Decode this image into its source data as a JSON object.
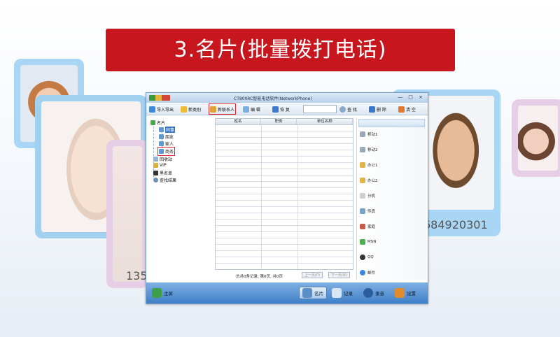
{
  "banner": {
    "title": "3.名片(批量拨打电话)"
  },
  "background": {
    "phone_right": "684920301",
    "phone_left": "135"
  },
  "window": {
    "title": "CT800RC智能电话软件(NetworkPhone)",
    "controls": "— □ ×"
  },
  "toolbar": {
    "import_export": "导入导出",
    "new_category": "新类别",
    "new_contact": "新联系人",
    "edit": "编  辑",
    "restore": "恢  复",
    "search_value": "",
    "find": "查  找",
    "delete": "删  除",
    "clear": "清  空"
  },
  "tree": {
    "root": "名片",
    "children": [
      "同事",
      "朋友",
      "家人",
      "商务"
    ],
    "recycle": "回收站",
    "vip": "VIP",
    "blacklist": "黑名单",
    "search_results": "查找结果"
  },
  "grid": {
    "columns": [
      "姓名",
      "职务",
      "单位名称"
    ],
    "status": "总共0条记录, 第0页, 共0页",
    "prev_page": "上一页(P)",
    "next_page": "下一页(N)"
  },
  "sidepanel": {
    "items": [
      "移动1",
      "移动2",
      "办公1",
      "办公2",
      "分机",
      "传真",
      "家庭",
      "MSN",
      "QQ",
      "邮件"
    ]
  },
  "bottombar": {
    "home": "主屏",
    "card": "名片",
    "record": "记录",
    "recording": "录音",
    "settings": "设置"
  },
  "colors": {
    "banner_red": "#c7161e",
    "highlight_red": "#e0262d",
    "selected_blue": "#3a75c4"
  }
}
